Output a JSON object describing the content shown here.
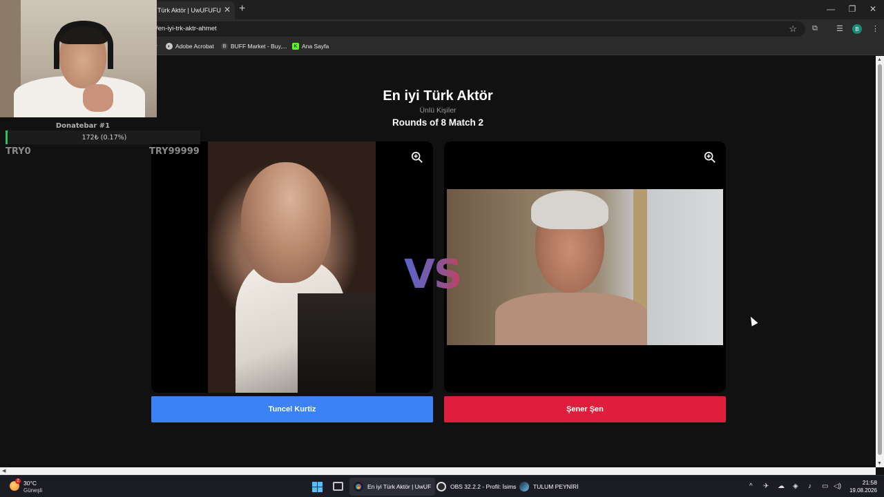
{
  "browser": {
    "tab_title": "Türk Aktör | UwUFUFU",
    "tab_close": "✕",
    "new_tab": "+",
    "url": "/en-iyi-trk-aktr-ahmet",
    "profile_initial": "B",
    "window_controls": {
      "minimize": "—",
      "maximize": "❐",
      "close": "✕"
    },
    "bookmarks": [
      {
        "label": "r",
        "icon": "bookmark-icon"
      },
      {
        "label": "Adobe Acrobat",
        "icon": "acrobat-icon"
      },
      {
        "label": "BUFF Market - Buy,...",
        "icon": "buff-icon"
      },
      {
        "label": "Ana Sayfa",
        "icon": "kick-icon"
      }
    ]
  },
  "page": {
    "title": "En iyi Türk Aktör",
    "category": "Ünlü Kişiler",
    "round": "Rounds of 8 Match 2",
    "vs": "VS",
    "left_choice": "Tuncel Kurtiz",
    "right_choice": "Şener Şen",
    "colors": {
      "left": "#3b82f6",
      "right": "#e11d3c",
      "background": "#111111"
    }
  },
  "overlay": {
    "donate_title": "Donatebar #1",
    "donate_value": "172₺ (0.17%)",
    "donate_progress": 0.0017,
    "donate_min": "TRY0",
    "donate_max": "TRY99999"
  },
  "taskbar": {
    "weather_temp": "30°C",
    "weather_desc": "Güneşli",
    "weather_badge": "2",
    "apps": [
      {
        "label": "En iyi Türk Aktör | UwUF",
        "icon": "chrome-icon",
        "active": true
      },
      {
        "label": "OBS 32.2.2 - Profil: İsims",
        "icon": "obs-icon",
        "active": false
      },
      {
        "label": "TULUM PEYNİRİ",
        "icon": "steam-icon",
        "active": false
      }
    ],
    "clock_time": "21:58",
    "clock_date": "19.08.2026"
  }
}
